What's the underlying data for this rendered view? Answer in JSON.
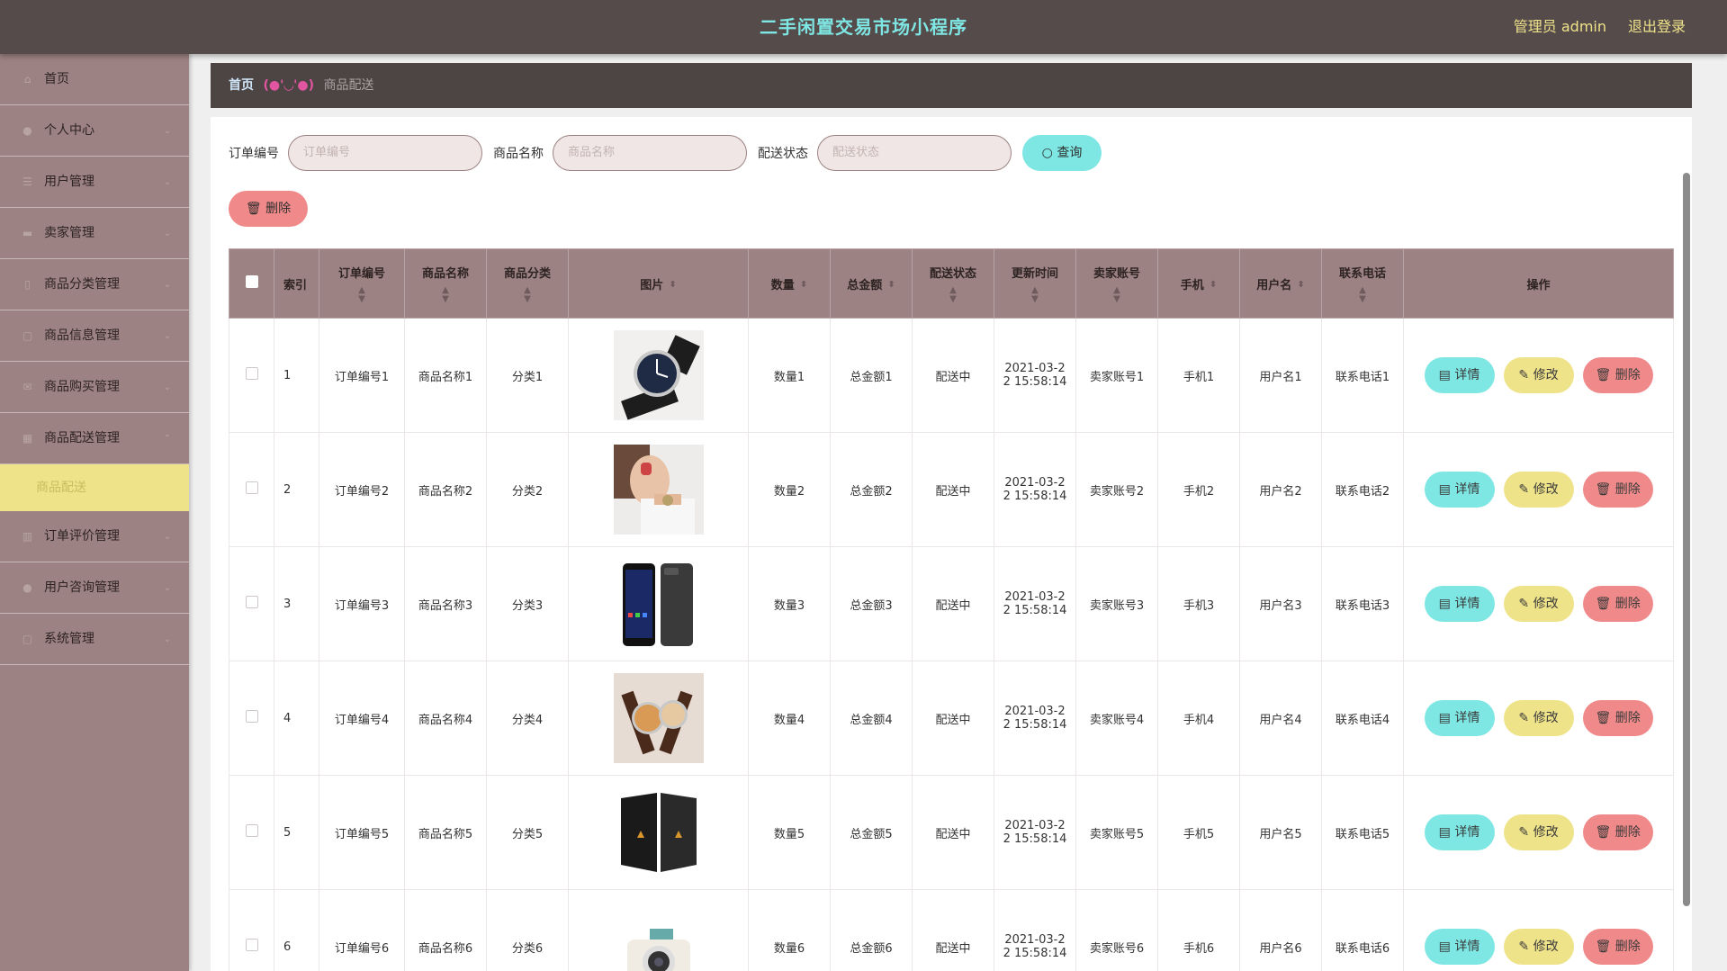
{
  "header": {
    "title": "二手闲置交易市场小程序",
    "user": "管理员 admin",
    "logout": "退出登录"
  },
  "sidebar": {
    "items": [
      {
        "label": "首页",
        "icon": "home-icon"
      },
      {
        "label": "个人中心",
        "icon": "person-icon"
      },
      {
        "label": "用户管理",
        "icon": "list-icon"
      },
      {
        "label": "卖家管理",
        "icon": "seller-icon"
      },
      {
        "label": "商品分类管理",
        "icon": "category-icon"
      },
      {
        "label": "商品信息管理",
        "icon": "document-icon"
      },
      {
        "label": "商品购买管理",
        "icon": "mail-icon"
      },
      {
        "label": "商品配送管理",
        "icon": "grid-icon"
      },
      {
        "label": "订单评价管理",
        "icon": "chart-icon"
      },
      {
        "label": "用户咨询管理",
        "icon": "person-icon"
      },
      {
        "label": "系统管理",
        "icon": "settings-icon"
      }
    ],
    "active_sub": "商品配送"
  },
  "breadcrumb": {
    "home": "首页",
    "face": "(●'◡'●)",
    "current": "商品配送"
  },
  "search": {
    "order_label": "订单编号",
    "order_placeholder": "订单编号",
    "name_label": "商品名称",
    "name_placeholder": "商品名称",
    "status_label": "配送状态",
    "status_placeholder": "配送状态",
    "query_button": "查询",
    "delete_button": "删除"
  },
  "table": {
    "headers": [
      "索引",
      "订单编号",
      "商品名称",
      "商品分类",
      "图片",
      "数量",
      "总金额",
      "配送状态",
      "更新时间",
      "卖家账号",
      "手机",
      "用户名",
      "联系电话",
      "操作"
    ],
    "actions": {
      "detail": "详情",
      "edit": "修改",
      "delete": "删除"
    },
    "rows": [
      {
        "index": "1",
        "order": "订单编号1",
        "name": "商品名称1",
        "category": "分类1",
        "qty": "数量1",
        "total": "总金额1",
        "status": "配送中",
        "time1": "2021-03-2",
        "time2": "2 15:58:14",
        "seller": "卖家账号1",
        "phone": "手机1",
        "user": "用户名1",
        "tel": "联系电话1",
        "image": "watch"
      },
      {
        "index": "2",
        "order": "订单编号2",
        "name": "商品名称2",
        "category": "分类2",
        "qty": "数量2",
        "total": "总金额2",
        "status": "配送中",
        "time1": "2021-03-2",
        "time2": "2 15:58:14",
        "seller": "卖家账号2",
        "phone": "手机2",
        "user": "用户名2",
        "tel": "联系电话2",
        "image": "woman-watch"
      },
      {
        "index": "3",
        "order": "订单编号3",
        "name": "商品名称3",
        "category": "分类3",
        "qty": "数量3",
        "total": "总金额3",
        "status": "配送中",
        "time1": "2021-03-2",
        "time2": "2 15:58:14",
        "seller": "卖家账号3",
        "phone": "手机3",
        "user": "用户名3",
        "tel": "联系电话3",
        "image": "phones"
      },
      {
        "index": "4",
        "order": "订单编号4",
        "name": "商品名称4",
        "category": "分类4",
        "qty": "数量4",
        "total": "总金额4",
        "status": "配送中",
        "time1": "2021-03-2",
        "time2": "2 15:58:14",
        "seller": "卖家账号4",
        "phone": "手机4",
        "user": "用户名4",
        "tel": "联系电话4",
        "image": "watch-pair"
      },
      {
        "index": "5",
        "order": "订单编号5",
        "name": "商品名称5",
        "category": "分类5",
        "qty": "数量5",
        "total": "总金额5",
        "status": "配送中",
        "time1": "2021-03-2",
        "time2": "2 15:58:14",
        "seller": "卖家账号5",
        "phone": "手机5",
        "user": "用户名5",
        "tel": "联系电话5",
        "image": "speakers"
      },
      {
        "index": "6",
        "order": "订单编号6",
        "name": "商品名称6",
        "category": "分类6",
        "qty": "数量6",
        "total": "总金额6",
        "status": "配送中",
        "time1": "2021-03-2",
        "time2": "2 15:58:14",
        "seller": "卖家账号6",
        "phone": "手机6",
        "user": "用户名6",
        "tel": "联系电话6",
        "image": "camera"
      }
    ]
  },
  "colors": {
    "header_bg": "#564b4b",
    "sidebar_bg": "#9c8282",
    "accent_cyan": "#7ee7e3",
    "accent_yellow": "#efe38a",
    "accent_red": "#f08a8a"
  }
}
